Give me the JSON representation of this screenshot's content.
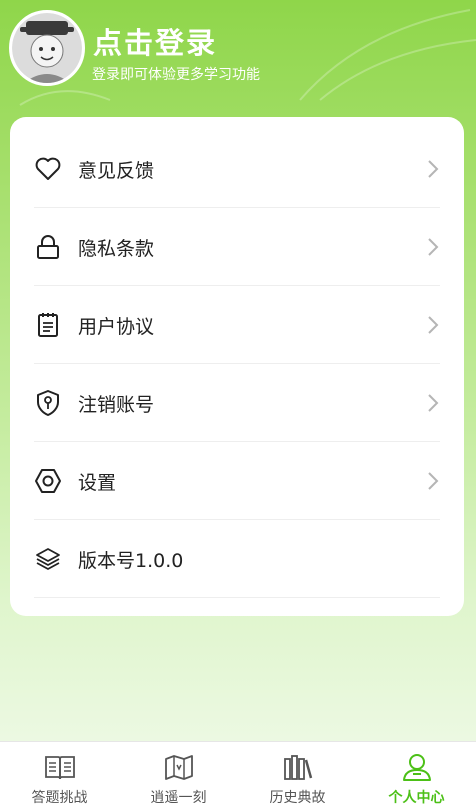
{
  "header": {
    "title": "点击登录",
    "subtitle": "登录即可体验更多学习功能",
    "avatar_icon": "cartoon-avatar-icon"
  },
  "menu": [
    {
      "label": "意见反馈",
      "icon": "heart-icon"
    },
    {
      "label": "隐私条款",
      "icon": "lock-icon"
    },
    {
      "label": "用户协议",
      "icon": "clipboard-icon"
    },
    {
      "label": "注销账号",
      "icon": "shield-key-icon"
    },
    {
      "label": "设置",
      "icon": "hexagon-settings-icon"
    },
    {
      "label": "版本号1.0.0",
      "icon": "layers-icon"
    }
  ],
  "tabbar": [
    {
      "label": "答题挑战",
      "icon": "open-book-icon",
      "active": false
    },
    {
      "label": "逍遥一刻",
      "icon": "map-icon",
      "active": false
    },
    {
      "label": "历史典故",
      "icon": "books-icon",
      "active": false
    },
    {
      "label": "个人中心",
      "icon": "person-icon",
      "active": true
    }
  ],
  "colors": {
    "accent": "#4cc017",
    "header_green": "#8fd64a",
    "card_bg": "#ffffff"
  }
}
